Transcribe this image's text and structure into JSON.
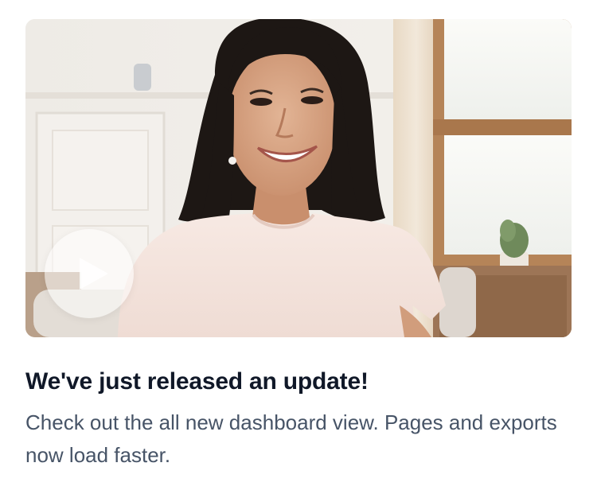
{
  "card": {
    "title": "We've just released an update!",
    "description": "Check out the all new dashboard view. Pages and exports now load faster."
  },
  "media": {
    "type": "video-thumbnail",
    "play_icon": "play-icon"
  },
  "colors": {
    "title": "#101828",
    "description": "#475467",
    "play_button_bg": "#ffffff"
  }
}
